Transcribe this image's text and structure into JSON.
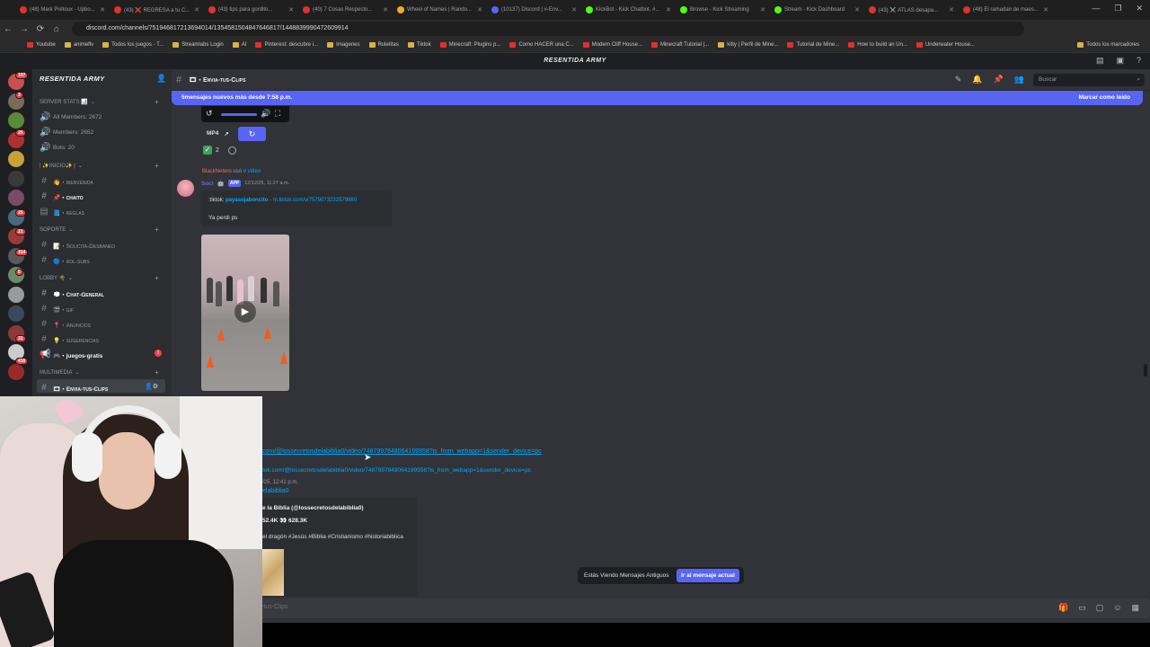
{
  "browser": {
    "tabs": [
      {
        "label": "(48) Mark Prétoux - Upbo...",
        "color": "#e0322c"
      },
      {
        "label": "(43) ❌ REGRESA a tu C...",
        "color": "#e0322c"
      },
      {
        "label": "(43) tips para gordito...",
        "color": "#e0322c"
      },
      {
        "label": "(40) 7 Cosas Respecto...",
        "color": "#e0322c"
      },
      {
        "label": "Wheel of Names | Rando...",
        "color": "#f5a623"
      },
      {
        "label": "(10137) Discord | #-Env...",
        "color": "#5865f2"
      },
      {
        "label": "KickBot - Kick Chatbot, #...",
        "color": "#53fc18"
      },
      {
        "label": "Browse - Kick Streaming",
        "color": "#53fc18"
      },
      {
        "label": "Stream - Kick Dashboard",
        "color": "#53fc18"
      },
      {
        "label": "(43) ⚔️ ATLAS desapa...",
        "color": "#e0322c"
      },
      {
        "label": "(48) El ramadan de maes...",
        "color": "#e0322c"
      }
    ],
    "url": "discord.com/channels/751946817213694014/1354581504847646817/1448839990472609914",
    "bookmarks": [
      {
        "label": "Youtube",
        "red": true
      },
      {
        "label": "animeflv",
        "red": false
      },
      {
        "label": "Todos los juegos - T...",
        "red": false
      },
      {
        "label": "Streamlabs Login",
        "red": false
      },
      {
        "label": "AI",
        "red": false
      },
      {
        "label": "Pinterest: descubre i...",
        "red": true
      },
      {
        "label": "Imagenes",
        "red": false
      },
      {
        "label": "Ruletitas",
        "red": false
      },
      {
        "label": "Tiktok",
        "red": false
      },
      {
        "label": "Minecraft: Plugins p...",
        "red": true
      },
      {
        "label": "Como HACER una C...",
        "red": true
      },
      {
        "label": "Modern Cliff House...",
        "red": true
      },
      {
        "label": "Minecraft Tutorial |...",
        "red": true
      },
      {
        "label": "kitty | Perfil de Mine...",
        "red": false
      },
      {
        "label": "Tutorial de Mine...",
        "red": true
      },
      {
        "label": "How to build an Un...",
        "red": true
      },
      {
        "label": "Underwater House...",
        "red": true
      }
    ],
    "bookmarks_right": "Todos los marcadores"
  },
  "discord_title": "RESENTIDA ARMY",
  "server": {
    "name": "RESENTIDA ARMY",
    "rail_badges": [
      "197",
      "3",
      "25",
      "25",
      "21",
      "314",
      "5",
      "31",
      "416"
    ],
    "channels": [
      {
        "label": "SERVER STATS 📊",
        "type": "cat",
        "plus": true
      },
      {
        "label": "All Members: 2672",
        "type": "stat"
      },
      {
        "label": "Members: 2652",
        "type": "stat"
      },
      {
        "label": "Bots: 20",
        "type": "stat"
      },
      {
        "label": "| ✨INICIO✨ |",
        "type": "cat",
        "plus": true
      },
      {
        "label": "👋・bienvenida",
        "type": "text",
        "style": "small"
      },
      {
        "label": "📌・chaito",
        "type": "text",
        "style": "bright"
      },
      {
        "label": "📘・reglas",
        "type": "rules",
        "style": "small"
      },
      {
        "label": "SOPORTE",
        "type": "cat",
        "plus": true
      },
      {
        "label": "📝・Solicita-Desbaneo",
        "type": "text",
        "style": "small"
      },
      {
        "label": "🔵・rol-subs",
        "type": "text",
        "style": "small"
      },
      {
        "label": "LOBBY 🌴",
        "type": "cat",
        "plus": true
      },
      {
        "label": "💭・Chat-General",
        "type": "text",
        "style": "bright"
      },
      {
        "label": "🎬・gif",
        "type": "text",
        "style": "small"
      },
      {
        "label": "📍・Anuncios",
        "type": "text",
        "style": "small"
      },
      {
        "label": "💡・sugerencias",
        "type": "text",
        "style": "small"
      },
      {
        "label": "🎮・juegos-gratis",
        "type": "announce",
        "style": "bright",
        "badge": "1"
      },
      {
        "label": "MULTIMEDIA",
        "type": "cat",
        "plus": true
      },
      {
        "label": "🎞・Envia-tus-Clips",
        "type": "text",
        "style": "active"
      }
    ]
  },
  "channel": {
    "title": "🎞・Envia-tus-Clips",
    "search_placeholder": "Buscar",
    "new_messages": "5mensajes nuevos más desde 7:58 p.m.",
    "mark_read": "Marcar como leído"
  },
  "messages": {
    "mp4_label": "MP4",
    "reaction_count": "2",
    "reply_user": "BlackNetero",
    "reply_used": "usó",
    "reply_cmd": "# video",
    "author": "Soci",
    "app_tag": "APP",
    "timestamp": "12/12/25, 11:27 a.m.",
    "embed_prefix": ":tiktok:",
    "embed_user": "payasojaboncito",
    "embed_link": "- m.tiktok.com/v/7579073232579860",
    "embed_text": "Ya perdi ps",
    "link_main": "com/@lossecretosdelabiblia0/video/7487997848064199958?is_from_webapp=1&sender_device=pc",
    "link_sub": "tok.com/@lossecretosdelabiblia0/video/7487997848064199958?is_from_webapp=1&sender_device=pc",
    "timestamp2": "/25, 12:41 p.m.",
    "user2": "elabiblia0",
    "embed2_title": "e la Biblia (@lossecretosdelabiblia0)",
    "embed2_stats": "52.4K 👀 628.3K",
    "embed2_desc": "el dragón #Jesús #Biblia #Cristianismo #historiabiblica"
  },
  "jump": {
    "old": "Estás Viendo Mensajes Antiguos",
    "button": "Ir al mensaje actual"
  },
  "composer_placeholder": "-tus-Clips"
}
